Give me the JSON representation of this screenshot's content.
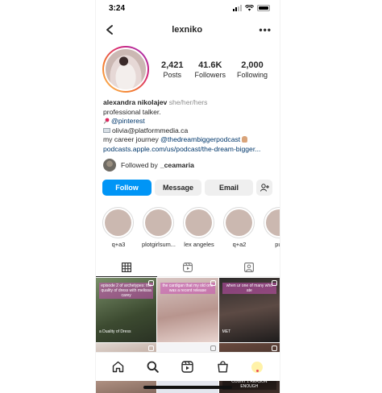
{
  "status_bar": {
    "time": "3:24"
  },
  "header": {
    "username": "lexniko",
    "more_label": "•••"
  },
  "stats": [
    {
      "value": "2,421",
      "label": "Posts"
    },
    {
      "value": "41.6K",
      "label": "Followers"
    },
    {
      "value": "2,000",
      "label": "Following"
    }
  ],
  "bio": {
    "name": "alexandra nikolajev",
    "pronouns": "she/her/hers",
    "line1": "professional talker.",
    "pinterest": "@pinterest",
    "email": "olivia@platformmedia.ca",
    "career_prefix": "my career journey ",
    "career_handle": "@thedreambiggerpodcast",
    "link": "podcasts.apple.com/us/podcast/the-dream-bigger..."
  },
  "followed_by": {
    "prefix": "Followed by",
    "name": "_ceamaria"
  },
  "actions": {
    "follow": "Follow",
    "message": "Message",
    "email": "Email"
  },
  "highlights": [
    {
      "label": "q+a3"
    },
    {
      "label": "plotgirlsum..."
    },
    {
      "label": "lex angeles"
    },
    {
      "label": "q+a2"
    },
    {
      "label": "pull"
    }
  ],
  "grid": [
    {
      "caption": "episode 2 of archetypes: the quality of dress with melissa carey",
      "sub": "a Duality of Dress"
    },
    {
      "caption": "the cardigan that my old one was a recent release",
      "sub": ""
    },
    {
      "caption": "when ur one of many who ate",
      "sub": "MET"
    },
    {
      "caption": "",
      "sub": ""
    },
    {
      "caption": "",
      "sub": ""
    },
    {
      "caption": "COUNT 1 REASON ENOUGH",
      "sub": ""
    }
  ],
  "colors": {
    "accent": "#0095f6",
    "link": "#00376b",
    "secondary_text": "#8e8e8e"
  },
  "icons": {
    "back": "chevron-left-icon",
    "more": "more-horizontal-icon",
    "add_person": "add-person-icon",
    "grid_tab": "grid-icon",
    "reels_tab": "reels-icon",
    "tagged_tab": "tagged-icon",
    "nav": [
      "home-icon",
      "search-icon",
      "reels-icon",
      "shop-icon",
      "profile-avatar"
    ]
  }
}
